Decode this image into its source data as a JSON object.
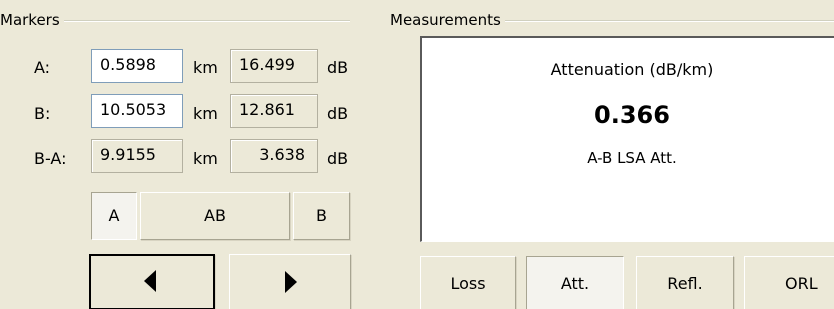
{
  "markers": {
    "title": "Markers",
    "rows": [
      {
        "label": "A:",
        "distance": "0.5898",
        "distance_unit": "km",
        "level": "16.499",
        "level_unit": "dB"
      },
      {
        "label": "B:",
        "distance": "10.5053",
        "distance_unit": "km",
        "level": "12.861",
        "level_unit": "dB"
      },
      {
        "label": "B-A:",
        "distance": "9.9155",
        "distance_unit": "km",
        "level": "3.638",
        "level_unit": "dB"
      }
    ],
    "select_buttons": {
      "a": "A",
      "ab": "AB",
      "b": "B"
    },
    "nav_buttons": {
      "left_icon": "triangle-left",
      "right_icon": "triangle-right"
    }
  },
  "measurements": {
    "title": "Measurements",
    "display": {
      "title": "Attenuation (dB/km)",
      "value": "0.366",
      "subtitle": "A-B LSA Att."
    },
    "tabs": [
      {
        "label": "Loss"
      },
      {
        "label": "Att."
      },
      {
        "label": "Refl."
      },
      {
        "label": "ORL"
      }
    ],
    "active_tab": "Att."
  }
}
